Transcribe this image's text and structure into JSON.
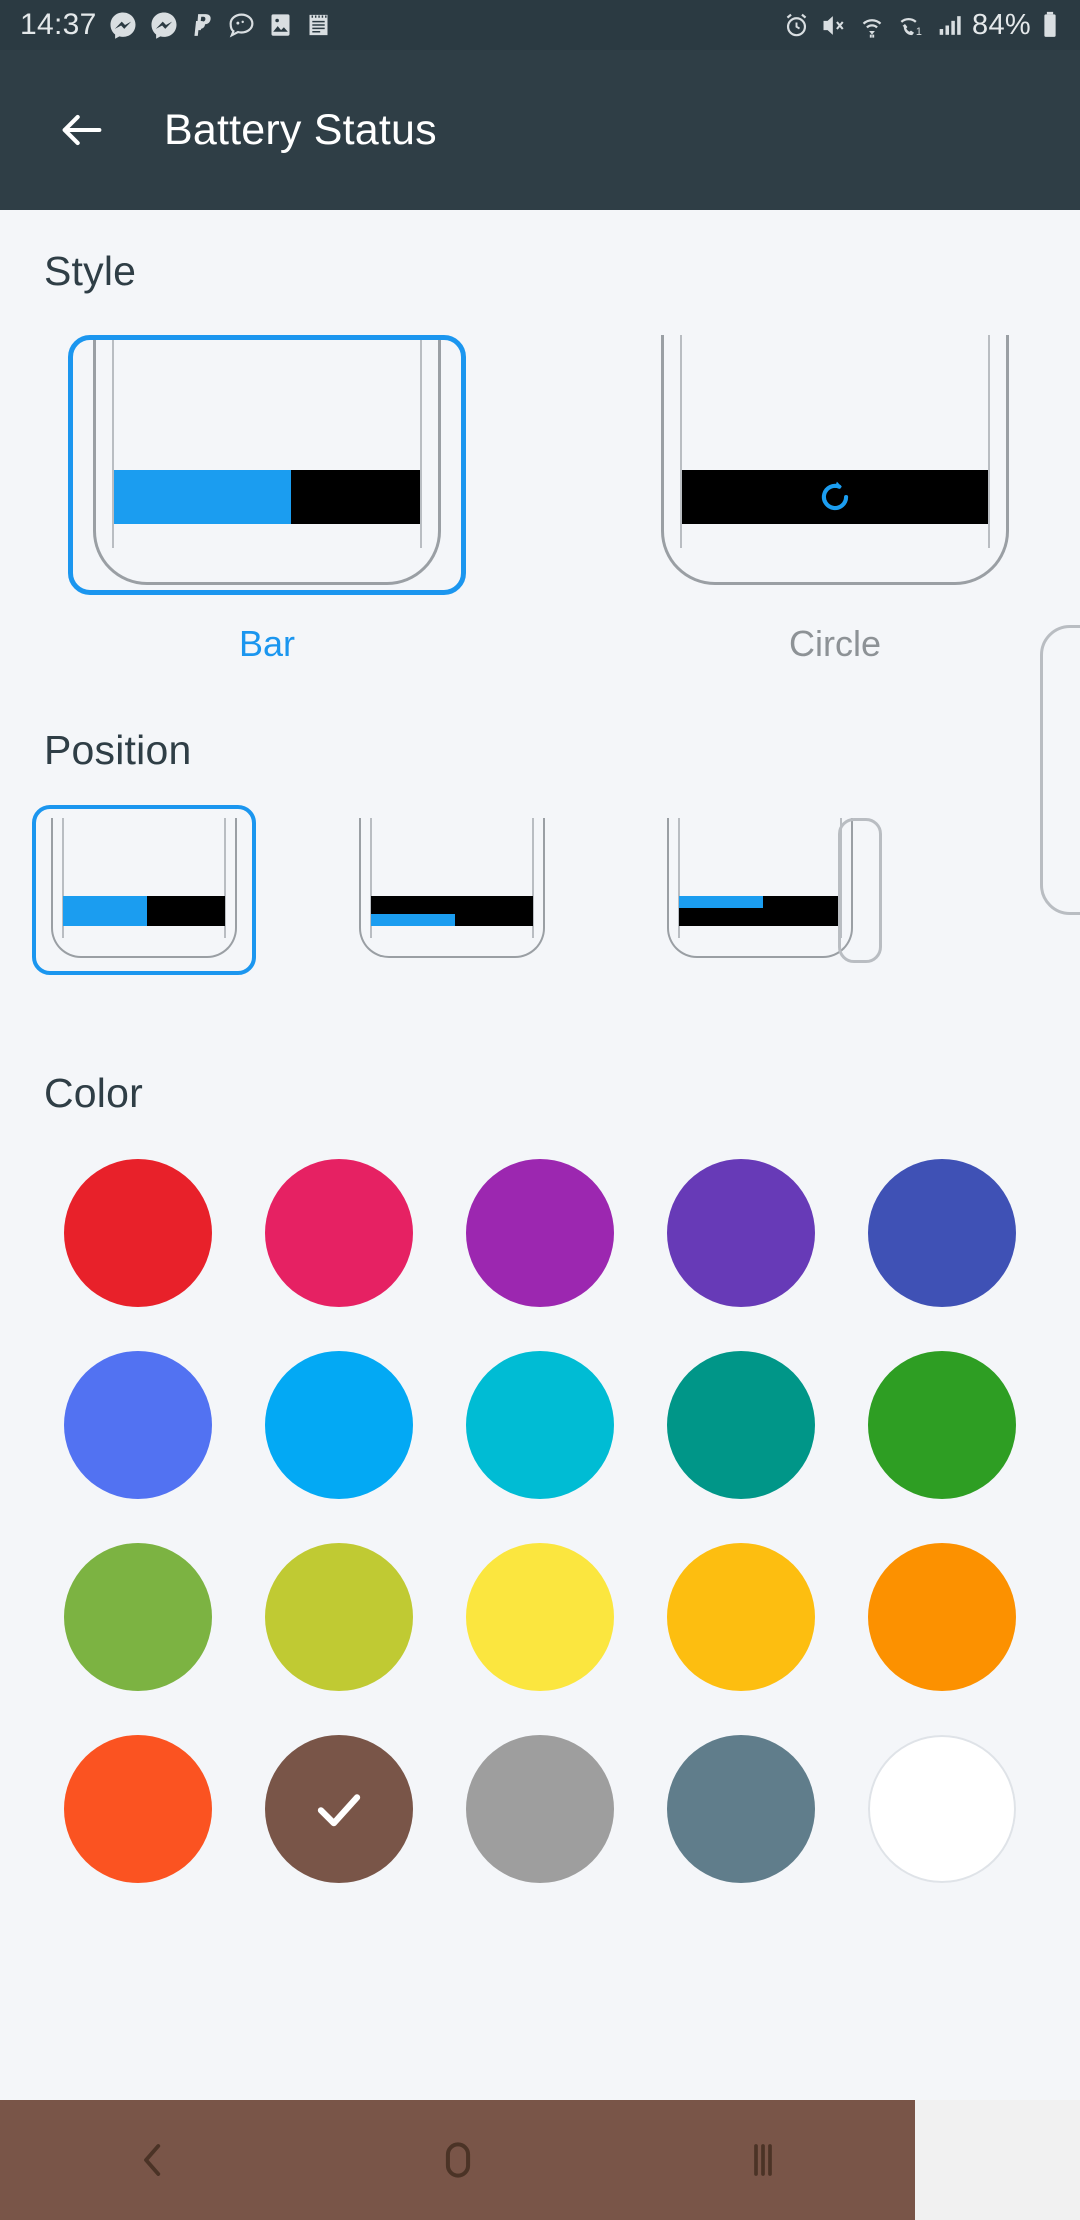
{
  "status_bar": {
    "time": "14:37",
    "battery_percent": "84%",
    "left_icons": [
      "messenger-icon",
      "messenger-icon",
      "paypal-icon",
      "chat-bubble-icon",
      "gallery-icon",
      "notes-icon"
    ],
    "right_icons": [
      "alarm-icon",
      "mute-vibrate-icon",
      "wifi-icon",
      "call-wifi-icon",
      "signal-bars-icon",
      "battery-icon"
    ],
    "background_color": "#2b3a42"
  },
  "app_bar": {
    "title": "Battery Status",
    "back_icon": "arrow-left-icon",
    "background_color": "#2f3e46",
    "text_color": "#ffffff"
  },
  "sections": {
    "style": {
      "heading": "Style",
      "selected_index": 0,
      "options": [
        {
          "label": "Bar",
          "preview": "bar",
          "selected": true
        },
        {
          "label": "Circle",
          "preview": "circle",
          "selected": false
        }
      ]
    },
    "position": {
      "heading": "Position",
      "selected_index": 0,
      "options": [
        {
          "name": "position-full",
          "fill": "full",
          "selected": true
        },
        {
          "name": "position-bottom",
          "fill": "bottom",
          "selected": false
        },
        {
          "name": "position-top",
          "fill": "top",
          "selected": false
        }
      ]
    },
    "color": {
      "heading": "Color",
      "selected_index": 16,
      "selected_color": "#795548",
      "check_icon": "check-icon",
      "swatches": [
        {
          "name": "color-red",
          "hex": "#e8212a"
        },
        {
          "name": "color-pink",
          "hex": "#e62163"
        },
        {
          "name": "color-purple",
          "hex": "#9c27b0"
        },
        {
          "name": "color-deep-purple",
          "hex": "#673ab7"
        },
        {
          "name": "color-indigo",
          "hex": "#3f51b5"
        },
        {
          "name": "color-blue",
          "hex": "#5272f2"
        },
        {
          "name": "color-light-blue",
          "hex": "#03a9f4"
        },
        {
          "name": "color-cyan",
          "hex": "#00bcd4"
        },
        {
          "name": "color-teal",
          "hex": "#009688"
        },
        {
          "name": "color-green",
          "hex": "#2e9e23"
        },
        {
          "name": "color-light-green",
          "hex": "#7cb342"
        },
        {
          "name": "color-lime",
          "hex": "#c0ca33"
        },
        {
          "name": "color-yellow",
          "hex": "#fbe63f"
        },
        {
          "name": "color-amber",
          "hex": "#fdbe10"
        },
        {
          "name": "color-orange",
          "hex": "#fc9100"
        },
        {
          "name": "color-deep-orange",
          "hex": "#fb5321"
        },
        {
          "name": "color-brown",
          "hex": "#795548"
        },
        {
          "name": "color-grey",
          "hex": "#9e9e9e"
        },
        {
          "name": "color-blue-grey",
          "hex": "#607d8b"
        },
        {
          "name": "color-white",
          "hex": "#ffffff"
        }
      ]
    }
  },
  "nav_bar": {
    "background_color": "#795548",
    "back_icon": "chevron-left-icon",
    "home_icon": "home-circle-icon",
    "recents_icon": "recents-bars-icon"
  },
  "accent_color": "#1b96ef",
  "page_background": "#f4f6f9"
}
